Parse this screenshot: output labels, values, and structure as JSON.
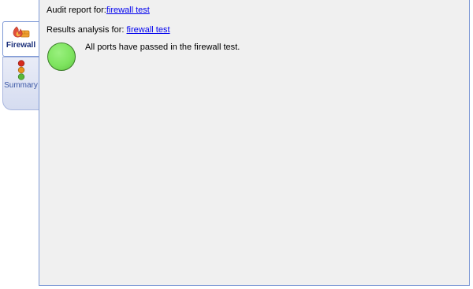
{
  "tabs": [
    {
      "label": "Firewall",
      "icon": "firewall-icon",
      "active": true
    },
    {
      "label": "Summary",
      "icon": "traffic-light-icon",
      "active": false
    }
  ],
  "report": {
    "audit_label": "Audit report for:",
    "audit_link": "firewall test",
    "results_label": "Results analysis for:",
    "results_link": "firewall test"
  },
  "status": {
    "message": "All ports have passed in the firewall test.",
    "light_color": "#7ee45f",
    "result": "passed"
  },
  "colors": {
    "panel_background": "#f0f0f0",
    "panel_border": "#7f9ad6",
    "link": "#0000ee"
  }
}
